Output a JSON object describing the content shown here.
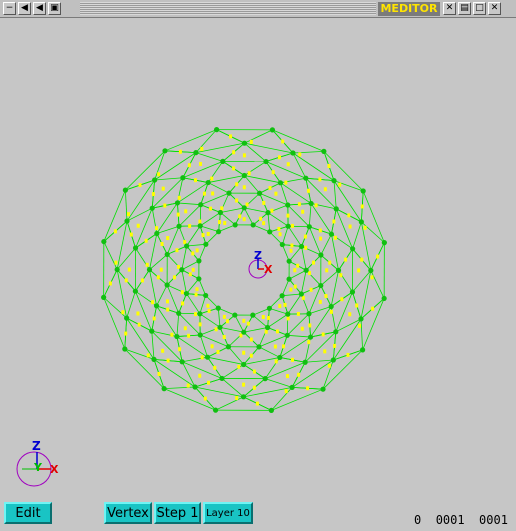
{
  "window": {
    "title": "MEDITOR",
    "left_buttons": [
      "−",
      "◀",
      "◀",
      "▣"
    ],
    "right_buttons": [
      "✕",
      "▤",
      "□",
      "✕"
    ]
  },
  "colors": {
    "background": "#c6c6c6",
    "mesh_edges": "#00e000",
    "vertices": "#10c010",
    "face_markers": "#ffff00",
    "axis_z": "#0000d0",
    "axis_x": "#e00000",
    "axis_y": "#00c000",
    "axis_circle": "#a000c0",
    "button": "#19c4c4",
    "title_text": "#ffe400"
  },
  "mesh": {
    "segments": 16,
    "rings": 6
  },
  "center_axis": {
    "z": "Z",
    "x": "X"
  },
  "corner_axis": {
    "z": "Z",
    "y": "Y",
    "x": "X"
  },
  "toolbar": {
    "edit": "Edit",
    "vertex": "Vertex",
    "step": "Step 1",
    "layer": "Layer 10"
  },
  "status": {
    "value_a": "0",
    "value_b": "0001",
    "value_c": "0001"
  }
}
